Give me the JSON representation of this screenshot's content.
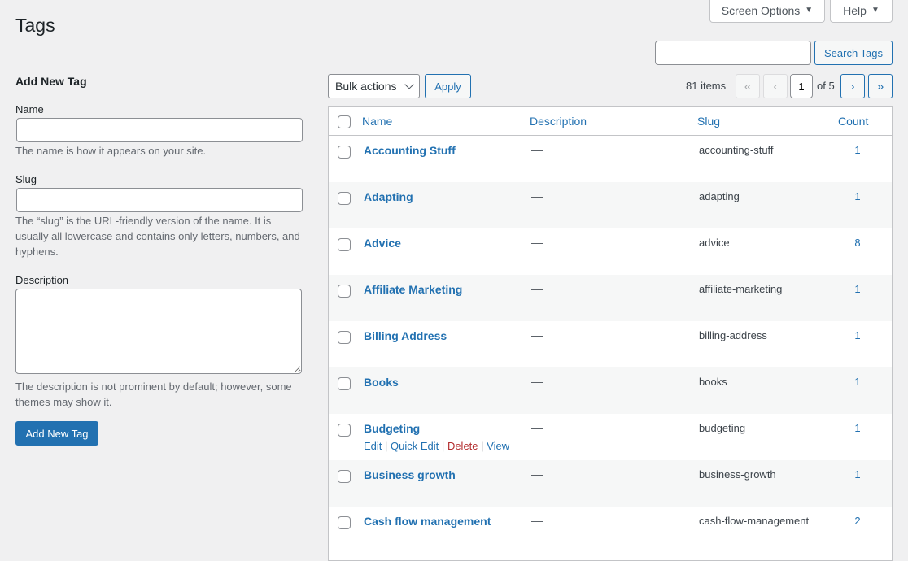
{
  "header": {
    "title": "Tags",
    "screen_options_label": "Screen Options",
    "help_label": "Help"
  },
  "search": {
    "value": "",
    "placeholder": "",
    "button_label": "Search Tags"
  },
  "form": {
    "heading": "Add New Tag",
    "name_label": "Name",
    "name_value": "",
    "name_help": "The name is how it appears on your site.",
    "slug_label": "Slug",
    "slug_value": "",
    "slug_help": "The “slug” is the URL-friendly version of the name. It is usually all lowercase and contains only letters, numbers, and hyphens.",
    "description_label": "Description",
    "description_value": "",
    "description_help": "The description is not prominent by default; however, some themes may show it.",
    "submit_label": "Add New Tag"
  },
  "toolbar": {
    "bulk_selected": "Bulk actions",
    "apply_label": "Apply",
    "items_count": "81 items",
    "first_page": "«",
    "prev_page": "‹",
    "current_page": "1",
    "total_pages": "of 5",
    "next_page": "›",
    "last_page": "»"
  },
  "table": {
    "columns": {
      "name": "Name",
      "description": "Description",
      "slug": "Slug",
      "count": "Count"
    },
    "rows": [
      {
        "name": "Accounting Stuff",
        "description": "—",
        "slug": "accounting-stuff",
        "count": "1"
      },
      {
        "name": "Adapting",
        "description": "—",
        "slug": "adapting",
        "count": "1"
      },
      {
        "name": "Advice",
        "description": "—",
        "slug": "advice",
        "count": "8"
      },
      {
        "name": "Affiliate Marketing",
        "description": "—",
        "slug": "affiliate-marketing",
        "count": "1"
      },
      {
        "name": "Billing Address",
        "description": "—",
        "slug": "billing-address",
        "count": "1"
      },
      {
        "name": "Books",
        "description": "—",
        "slug": "books",
        "count": "1"
      },
      {
        "name": "Budgeting",
        "description": "—",
        "slug": "budgeting",
        "count": "1"
      },
      {
        "name": "Business growth",
        "description": "—",
        "slug": "business-growth",
        "count": "1"
      },
      {
        "name": "Cash flow management",
        "description": "—",
        "slug": "cash-flow-management",
        "count": "2"
      }
    ],
    "row_actions": {
      "edit": "Edit",
      "quick_edit": "Quick Edit",
      "delete": "Delete",
      "view": "View",
      "separator": "|"
    }
  },
  "colors": {
    "accent": "#2271b1",
    "delete": "#b32d2e",
    "background": "#f0f0f1"
  }
}
